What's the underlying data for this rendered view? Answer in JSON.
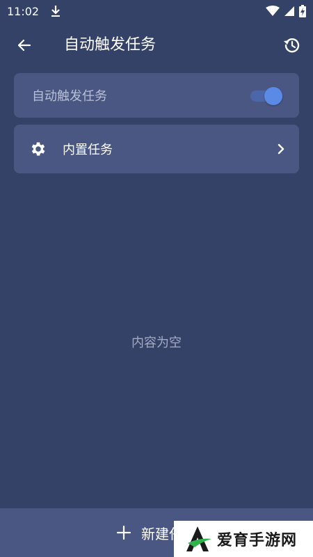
{
  "status_bar": {
    "time": "11:02",
    "icons": [
      "download-icon",
      "wifi-icon",
      "signal-icon",
      "battery-charging-icon"
    ]
  },
  "app_bar": {
    "title": "自动触发任务",
    "back_icon": "arrow-left-icon",
    "history_icon": "history-icon"
  },
  "toggle_card": {
    "label": "自动触发任务",
    "enabled": true
  },
  "builtin_card": {
    "icon": "gear-icon",
    "label": "内置任务",
    "chevron_icon": "chevron-right-icon"
  },
  "empty_state": {
    "text": "内容为空"
  },
  "bottom_bar": {
    "icon": "plus-icon",
    "label": "新建任务"
  },
  "watermark": {
    "text": "爱育手游网"
  },
  "colors": {
    "background": "#354267",
    "card": "#4a5782",
    "accent": "#5a8ae6"
  }
}
